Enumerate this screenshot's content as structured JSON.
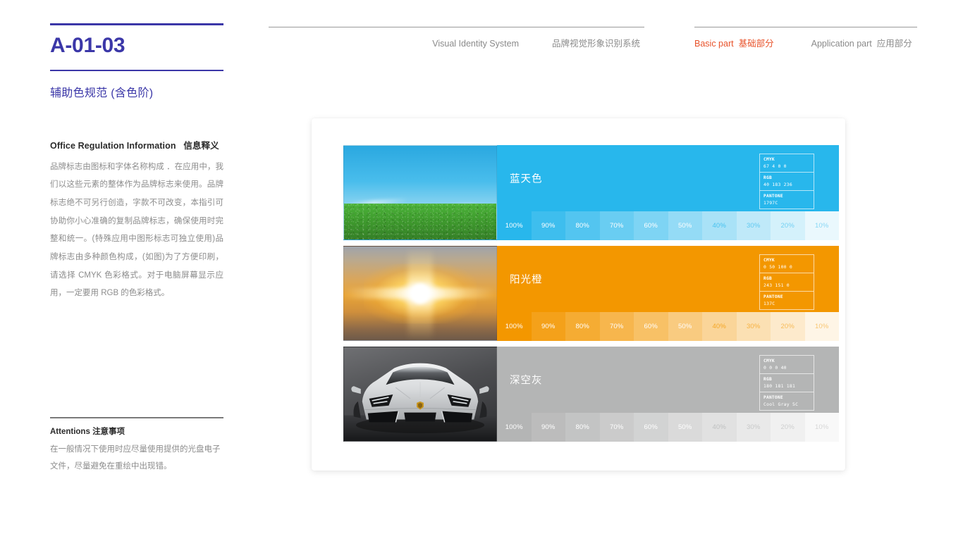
{
  "document": {
    "code": "A-01-03",
    "subtitle": "辅助色规范 (含色阶)"
  },
  "nav": {
    "system_en": "Visual Identity System",
    "system_cn": "品牌视觉形象识别系统",
    "basic_en": "Basic part",
    "basic_cn": "基础部分",
    "application_en": "Application part",
    "application_cn": "应用部分",
    "active_accent": "#e8522a"
  },
  "info": {
    "heading_en": "Office Regulation Information",
    "heading_cn": "信息释义",
    "body": "品牌标志由图标和字体名称构成 ．在应用中，我们以这些元素的整体作为品牌标志来使用。品牌标志绝不可另行创造，字款不可改变，本指引可协助你小心准确的复制品牌标志，确保使用时完整和统一。(特殊应用中图形标志可独立使用)品牌标志由多种颜色构成，(如图)为了方便印刷，请选择 CMYK 色彩格式。对于电脑屏幕显示应用，一定要用 RGB 的色彩格式。"
  },
  "attentions": {
    "heading_en": "Attentions",
    "heading_cn": "注意事项",
    "body": "在一般情况下使用时应尽量使用提供的光盘电子文件，尽量避免在重绘中出现错。"
  },
  "spec_labels": {
    "cmyk": "CMYK",
    "rgb": "RGB",
    "pantone": "PANTONE"
  },
  "tint_levels": [
    "100%",
    "90%",
    "80%",
    "70%",
    "60%",
    "50%",
    "40%",
    "30%",
    "20%",
    "10%"
  ],
  "colors": [
    {
      "name": "蓝天色",
      "hex": "#28b7ec",
      "cmyk": "67 4 0 0",
      "rgb": "40 183 236",
      "pantone": "1797C",
      "thumb": "sky-grass-photo"
    },
    {
      "name": "阳光橙",
      "hex": "#f39700",
      "cmyk": "0 50 100 0",
      "rgb": "243 151 0",
      "pantone": "137C",
      "thumb": "sunset-photo"
    },
    {
      "name": "深空灰",
      "hex": "#b4b5b5",
      "cmyk": "0 0 0 40",
      "rgb": "180 181 181",
      "pantone": "Cool Gray 5C",
      "thumb": "sports-car-photo"
    }
  ]
}
